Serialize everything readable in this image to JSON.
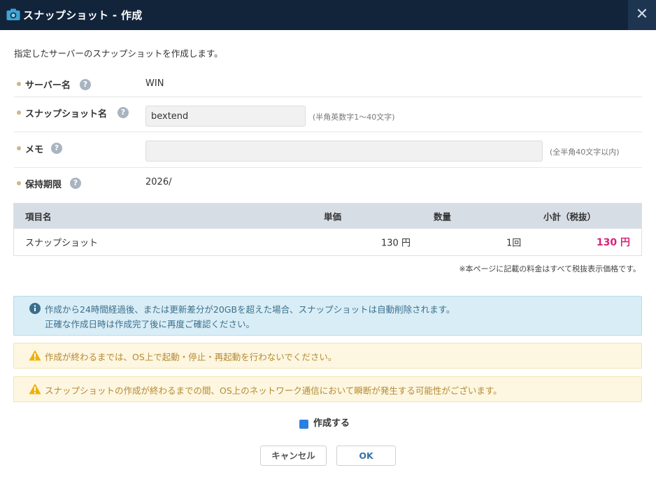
{
  "dialog": {
    "title": "スナップショット - 作成",
    "close_label": "✕",
    "intro": "指定したサーバーのスナップショットを作成します。"
  },
  "form": {
    "server_name": {
      "label": "サーバー名",
      "value": "WIN"
    },
    "snapshot_name": {
      "label": "スナップショット名",
      "value": "bextend",
      "hint": "(半角英数字1～40文字)"
    },
    "memo": {
      "label": "メモ",
      "value": "",
      "hint": "(全半角40文字以内)"
    },
    "retention": {
      "label": "保持期限",
      "value": "2026/"
    }
  },
  "table": {
    "headers": [
      "項目名",
      "単価",
      "数量",
      "小計（税抜）"
    ],
    "rows": [
      {
        "item": "スナップショット",
        "unit_price": "130 円",
        "quantity": "1回",
        "subtotal": "130 円"
      }
    ]
  },
  "note": "※本ページに記載の料金はすべて税抜表示価格です。",
  "alerts": {
    "info": {
      "line1": "作成から24時間経過後、または更新差分が20GBを超えた場合、スナップショットは自動削除されます。",
      "line2": "正確な作成日時は作成完了後に再度ご確認ください。"
    },
    "warn1": "作成が終わるまでは、OS上で起動・停止・再起動を行わないでください。",
    "warn2": "スナップショットの作成が終わるまでの間、OS上のネットワーク通信において瞬断が発生する可能性がございます。"
  },
  "confirm": {
    "label": "作成する",
    "checked": true
  },
  "buttons": {
    "cancel": "キャンセル",
    "ok": "OK"
  },
  "colors": {
    "titlebar": "#12243a",
    "price": "#d6237b",
    "checkbox": "#2a7fe0",
    "info_bg": "#d9edf6",
    "warn_bg": "#fdf6e0"
  },
  "icons": {
    "title": "camera-icon",
    "help": "question-circle-icon",
    "info": "info-circle-icon",
    "warn": "warning-triangle-icon"
  }
}
